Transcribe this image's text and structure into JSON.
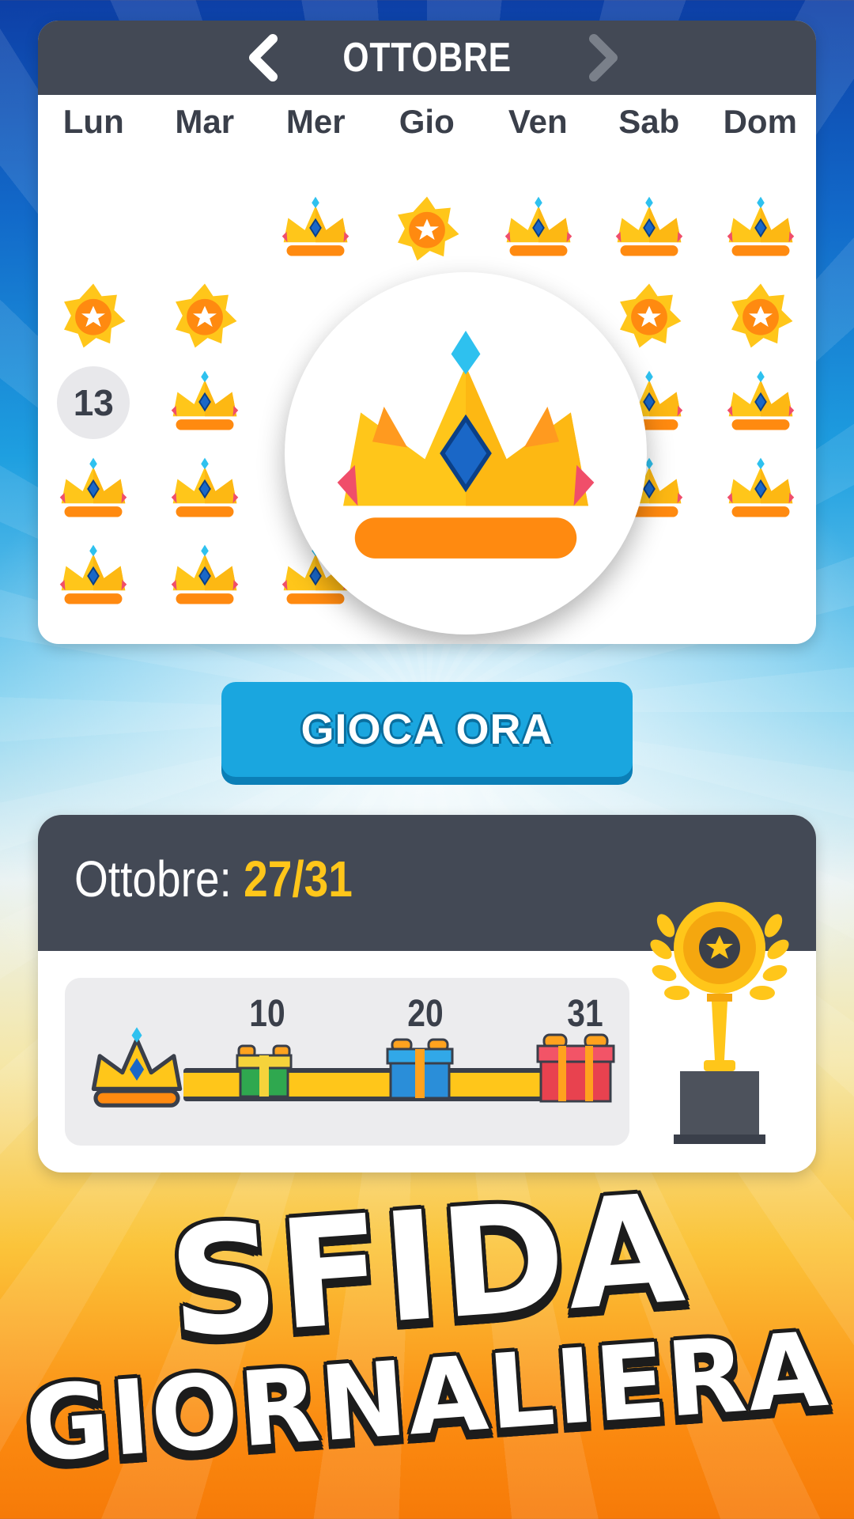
{
  "calendar": {
    "month": "OTTOBRE",
    "weekdays": [
      "Lun",
      "Mar",
      "Mer",
      "Gio",
      "Ven",
      "Sab",
      "Dom"
    ],
    "today_label": "13",
    "icons": {
      "crown": "crown-icon",
      "star": "star-medal-icon",
      "prev": "chevron-left-icon",
      "next": "chevron-right-icon"
    }
  },
  "play_button": {
    "label": "GIOCA ORA"
  },
  "progress": {
    "month_label": "Ottobre:",
    "count": "27/31",
    "completed": 27,
    "total": 31,
    "milestones": [
      "10",
      "20",
      "31"
    ]
  },
  "colors": {
    "header": "#434955",
    "accent_yellow": "#ffc61a",
    "button_blue": "#1aa6df",
    "crown_gold": "#ffc61a",
    "gem_blue": "#1a67c7"
  },
  "title": {
    "line1": "SFIDA",
    "line2": "GIORNALIERA"
  }
}
